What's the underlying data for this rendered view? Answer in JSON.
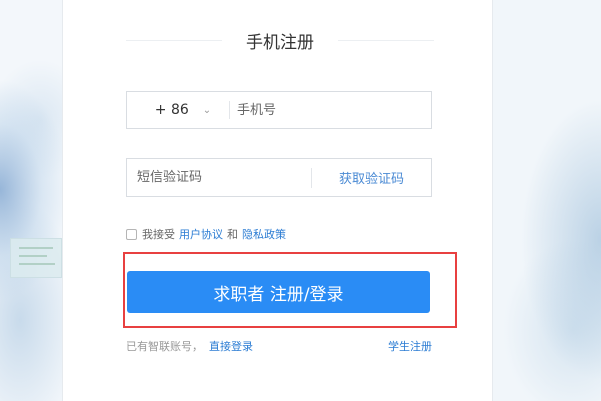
{
  "register": {
    "title": "手机注册",
    "country_code": "+ 86",
    "phone_placeholder": "手机号",
    "sms_placeholder": "短信验证码",
    "get_code_label": "获取验证码",
    "agree_prefix": "我接受",
    "user_agreement_link": "用户协议",
    "agree_and": "和",
    "privacy_policy_link": "隐私政策",
    "submit_label": "求职者 注册/登录",
    "existing_account_text": "已有智联账号，",
    "direct_login_link": "直接登录",
    "student_register_link": "学生注册"
  },
  "colors": {
    "primary_button": "#2a8cf5",
    "link": "#2b7cd3",
    "highlight_border": "#e84040"
  },
  "icons": {
    "country_dropdown": "chevron-down-icon"
  }
}
